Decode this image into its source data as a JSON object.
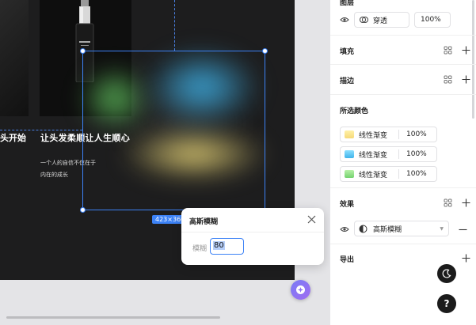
{
  "artboard": {
    "left_text": "头开始",
    "title": "让头发柔顺让人生顺心",
    "line1": "一个人的自信不仅在于",
    "line2": "内在的成长"
  },
  "selection": {
    "size_label": "423×360"
  },
  "blur_popup": {
    "title": "高斯模糊",
    "field_label": "模糊",
    "value": "80"
  },
  "panel": {
    "layer": {
      "title": "图层",
      "blend_mode": "穿透",
      "opacity": "100%"
    },
    "fill": {
      "title": "填充"
    },
    "stroke": {
      "title": "描边"
    },
    "selected_colors": {
      "title": "所选颜色",
      "items": [
        {
          "name": "线性渐变",
          "opacity": "100%",
          "color": "#f6d978"
        },
        {
          "name": "线性渐变",
          "opacity": "100%",
          "color": "#3fb4ea"
        },
        {
          "name": "线性渐变",
          "opacity": "100%",
          "color": "#74d26f"
        }
      ]
    },
    "effects": {
      "title": "效果",
      "effect_name": "高斯模糊"
    },
    "export": {
      "title": "导出"
    },
    "help_label": "?"
  },
  "icons": [
    "eye-icon",
    "blend-mode-icon",
    "grid-icon",
    "plus-icon",
    "minus-icon",
    "blur-effect-icon",
    "close-icon",
    "moon-icon",
    "ai-assistant-icon"
  ]
}
